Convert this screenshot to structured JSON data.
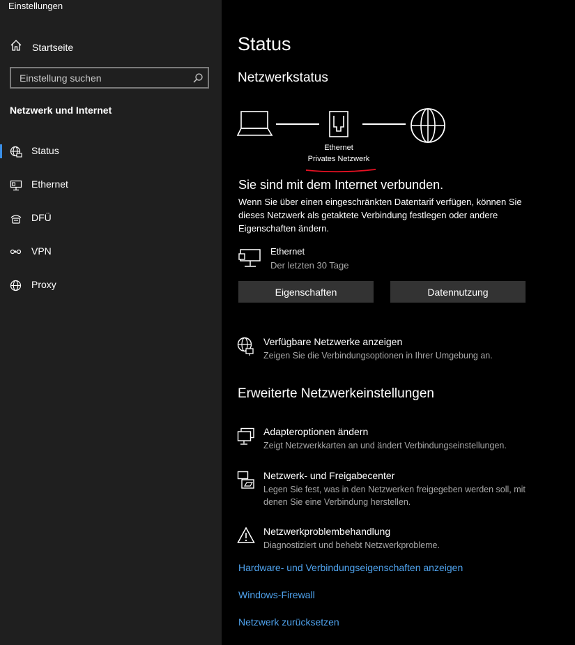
{
  "window": {
    "title": "Einstellungen"
  },
  "sidebar": {
    "home_label": "Startseite",
    "search_placeholder": "Einstellung suchen",
    "section_title": "Netzwerk und Internet",
    "items": [
      {
        "label": "Status",
        "icon": "globe-network-icon",
        "active": true
      },
      {
        "label": "Ethernet",
        "icon": "ethernet-icon",
        "active": false
      },
      {
        "label": "DFÜ",
        "icon": "dialup-icon",
        "active": false
      },
      {
        "label": "VPN",
        "icon": "vpn-icon",
        "active": false
      },
      {
        "label": "Proxy",
        "icon": "globe-icon",
        "active": false
      }
    ]
  },
  "main": {
    "title": "Status",
    "network_status_heading": "Netzwerkstatus",
    "diagram": {
      "adapter_label": "Ethernet",
      "network_type": "Privates Netzwerk",
      "underline_color": "#e81123"
    },
    "connected_heading": "Sie sind mit dem Internet verbunden.",
    "connected_desc": "Wenn Sie über einen eingeschränkten Datentarif verfügen, können Sie dieses Netzwerk als getaktete Verbindung festlegen oder andere Eigenschaften ändern.",
    "connection": {
      "name": "Ethernet",
      "period": "Der letzten 30 Tage"
    },
    "buttons": {
      "properties": "Eigenschaften",
      "data_usage": "Datennutzung"
    },
    "available": {
      "title": "Verfügbare Netzwerke anzeigen",
      "subtitle": "Zeigen Sie die Verbindungsoptionen in Ihrer Umgebung an."
    },
    "advanced_heading": "Erweiterte Netzwerkeinstellungen",
    "advanced": [
      {
        "title": "Adapteroptionen ändern",
        "subtitle": "Zeigt Netzwerkkarten an und ändert Verbindungseinstellungen."
      },
      {
        "title": "Netzwerk- und Freigabecenter",
        "subtitle": "Legen Sie fest, was in den Netzwerken freigegeben werden soll, mit denen Sie eine Verbindung herstellen."
      },
      {
        "title": "Netzwerkproblembehandlung",
        "subtitle": "Diagnostiziert und behebt Netzwerkprobleme."
      }
    ],
    "links": [
      "Hardware- und Verbindungseigenschaften anzeigen",
      "Windows-Firewall",
      "Netzwerk zurücksetzen"
    ]
  },
  "colors": {
    "accent": "#3a8ee6",
    "link": "#4fa3ee",
    "sidebar_bg": "#1f1f1f",
    "main_bg": "#000000"
  }
}
